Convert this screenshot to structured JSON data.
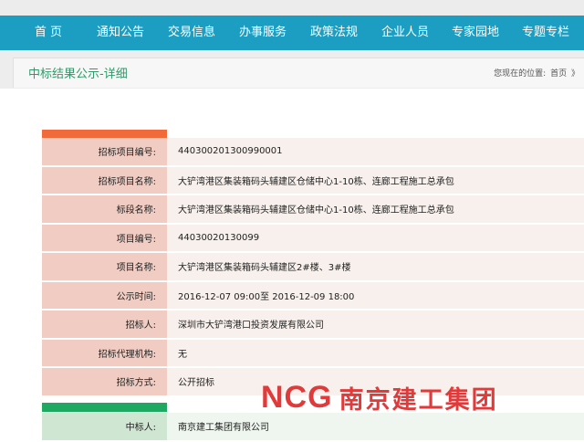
{
  "nav": {
    "items": [
      {
        "label": "首 页"
      },
      {
        "label": "通知公告"
      },
      {
        "label": "交易信息"
      },
      {
        "label": "办事服务"
      },
      {
        "label": "政策法规"
      },
      {
        "label": "企业人员"
      },
      {
        "label": "专家园地"
      },
      {
        "label": "专题专栏"
      }
    ]
  },
  "header": {
    "title": "中标结果公示-详细",
    "location_label": "您现在的位置:",
    "location_home": "首页",
    "location_sep": "》"
  },
  "section1": {
    "tab_label": "",
    "rows": [
      {
        "label": "招标项目编号:",
        "value": "440300201300990001"
      },
      {
        "label": "招标项目名称:",
        "value": "大铲湾港区集装箱码头辅建区仓储中心1-10栋、连廊工程施工总承包"
      },
      {
        "label": "标段名称:",
        "value": "大铲湾港区集装箱码头辅建区仓储中心1-10栋、连廊工程施工总承包"
      },
      {
        "label": "项目编号:",
        "value": "44030020130099"
      },
      {
        "label": "项目名称:",
        "value": "大铲湾港区集装箱码头辅建区2#楼、3#楼"
      },
      {
        "label": "公示时间:",
        "value": "2016-12-07 09:00至 2016-12-09 18:00"
      },
      {
        "label": "招标人:",
        "value": "深圳市大铲湾港口投资发展有限公司"
      },
      {
        "label": "招标代理机构:",
        "value": "无"
      },
      {
        "label": "招标方式:",
        "value": "公开招标"
      }
    ]
  },
  "section2": {
    "tab_label": "",
    "rows": [
      {
        "label": "中标人:",
        "value": "南京建工集团有限公司"
      }
    ]
  },
  "watermark": {
    "latin": "NCG",
    "chinese": "南京建工集团"
  },
  "colors": {
    "nav_bg": "#1b9ec2",
    "title_green": "#2e9a6a",
    "tab1": "#f06a3a",
    "tab2": "#1fa862",
    "logo_red": "#e03a3a"
  }
}
